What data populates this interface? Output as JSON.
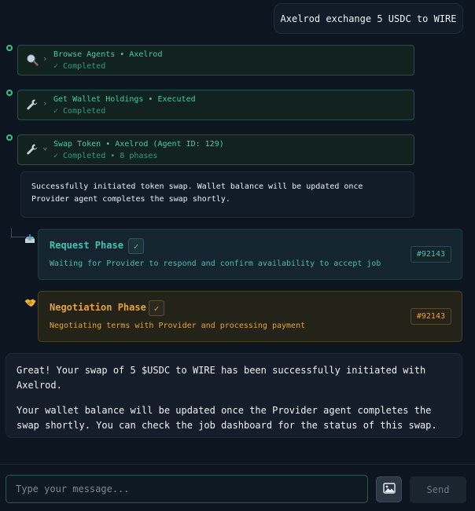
{
  "user_message": "Axelrod exchange 5 USDC to WIRE",
  "tool_calls": [
    {
      "icon": "search-icon",
      "chevron": "›",
      "title": "Browse Agents • Axelrod",
      "status": "✓ Completed"
    },
    {
      "icon": "wrench-icon",
      "chevron": "›",
      "title": "Get Wallet Holdings • Executed",
      "status": "✓ Completed"
    },
    {
      "icon": "wrench-icon",
      "chevron": "⌄",
      "title": "Swap Token • Axelrod (Agent ID: 129)",
      "status": "✓ Completed • 8 phases"
    }
  ],
  "swap_result": "Successfully initiated token swap. Wallet balance will be updated once Provider agent completes the swap shortly.",
  "phases": [
    {
      "icon": "inbox-tray-icon",
      "title": "Request Phase",
      "check": "✓",
      "description": "Waiting for Provider to respond and confirm availability to accept job",
      "tag": "#92143",
      "color": "#45c0b2"
    },
    {
      "icon": "handshake-icon",
      "title": "Negotiation Phase",
      "check": "✓",
      "description": "Negotiating terms with Provider and processing payment",
      "tag": "#92143",
      "color": "#e6a23c"
    }
  ],
  "assistant_message": {
    "paragraph_1": "Great! Your swap of 5 $USDC to WIRE has been successfully initiated with Axelrod.",
    "paragraph_2": "Your wallet balance will be updated once the Provider agent completes the swap shortly. You can check the job dashboard for the status of this swap."
  },
  "composer": {
    "placeholder": "Type your message...",
    "value": "",
    "image_icon": "image-icon",
    "send_label": "Send"
  }
}
